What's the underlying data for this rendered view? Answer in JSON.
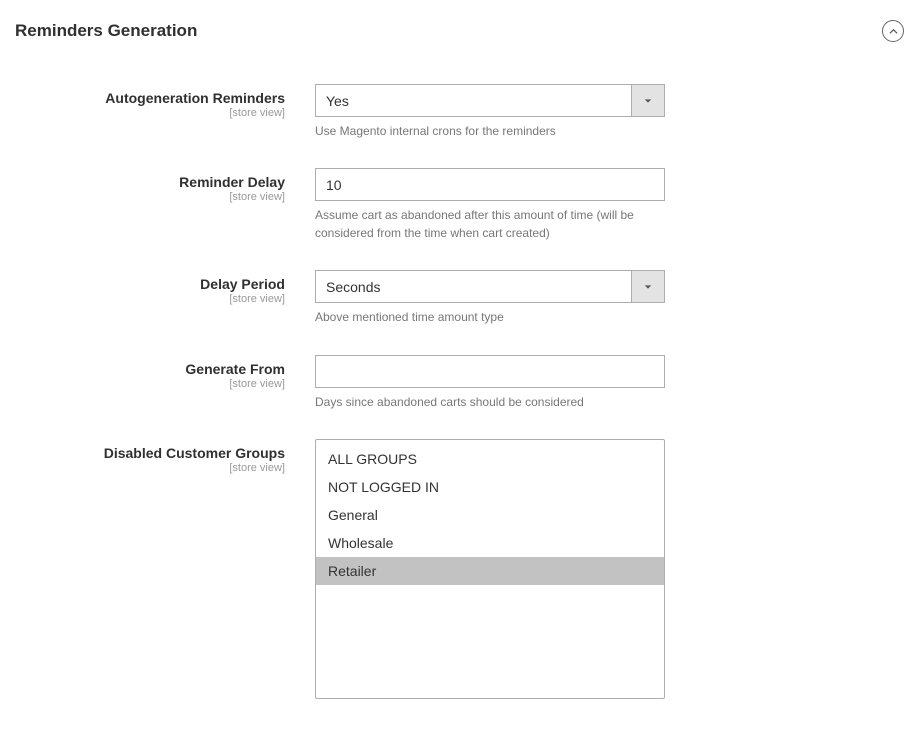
{
  "section": {
    "title": "Reminders Generation"
  },
  "scope_label": "[store view]",
  "fields": {
    "autogen": {
      "label": "Autogeneration Reminders",
      "value": "Yes",
      "hint": "Use Magento internal crons for the reminders"
    },
    "delay": {
      "label": "Reminder Delay",
      "value": "10",
      "hint": "Assume cart as abandoned after this amount of time (will be considered from the time when cart created)"
    },
    "period": {
      "label": "Delay Period",
      "value": "Seconds",
      "hint": "Above mentioned time amount type"
    },
    "generate_from": {
      "label": "Generate From",
      "value": "",
      "hint": "Days since abandoned carts should be considered"
    },
    "disabled_groups": {
      "label": "Disabled Customer Groups",
      "options": [
        "ALL GROUPS",
        "NOT LOGGED IN",
        "General",
        "Wholesale",
        "Retailer"
      ],
      "selected": [
        "Retailer"
      ]
    }
  }
}
